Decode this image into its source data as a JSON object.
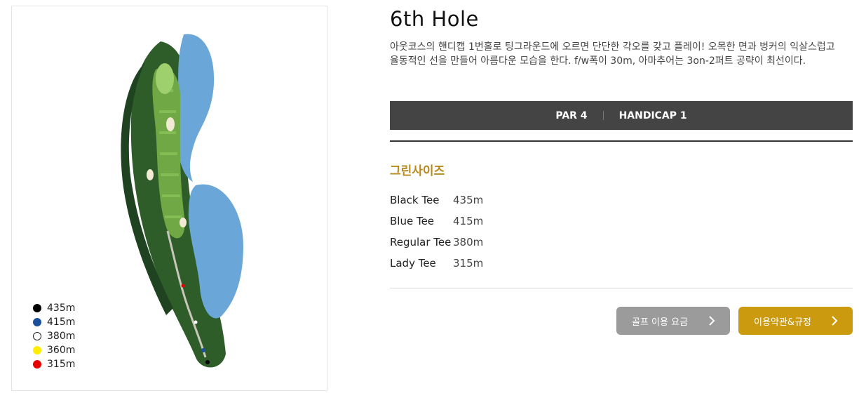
{
  "hole": {
    "title": "6th Hole",
    "description": "아웃코스의 핸디캡 1번홀로 팅그라운드에 오르면 단단한 각오를 갖고 플레이! 오목한 면과 벙커의 익살스럽고 율동적인 선을 만들어 아름다운 모습을 한다. f/w폭이 30m, 아마추어는 3on-2퍼트 공략이 최선이다."
  },
  "info_bar": {
    "par": "PAR 4",
    "handicap": "HANDICAP 1"
  },
  "green_size_title": "그린사이즈",
  "tees": [
    {
      "name": "Black Tee",
      "distance": "435m"
    },
    {
      "name": "Blue Tee",
      "distance": "415m"
    },
    {
      "name": "Regular Tee",
      "distance": "380m"
    },
    {
      "name": "Lady Tee",
      "distance": "315m"
    }
  ],
  "legend": [
    {
      "label": "435m",
      "color": "#000000"
    },
    {
      "label": "415m",
      "color": "#1a4f9c"
    },
    {
      "label": "380m",
      "color": "#ffffff"
    },
    {
      "label": "360m",
      "color": "#ffee00"
    },
    {
      "label": "315m",
      "color": "#e60000"
    }
  ],
  "buttons": {
    "fee": "골프 이용 요금",
    "terms": "이용약관&규정"
  },
  "colors": {
    "info_bar_bg": "#444444",
    "gold": "#cc9a0e",
    "green_title": "#b8891b",
    "gray_button": "#9b9b9b"
  }
}
